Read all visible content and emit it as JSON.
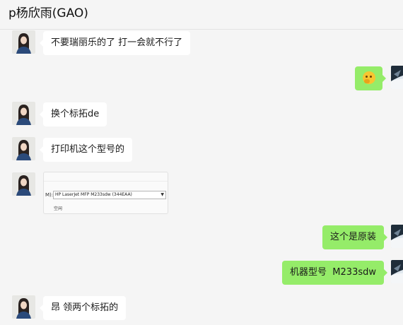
{
  "header": {
    "title": "p杨欣雨(GAO)"
  },
  "messages": [
    {
      "side": "left",
      "type": "text",
      "text": "不要瑞丽乐的了 打一会就不行了"
    },
    {
      "side": "right",
      "type": "emoji",
      "emoji": "thinking-face-icon"
    },
    {
      "side": "left",
      "type": "text",
      "text": "换个标拓de"
    },
    {
      "side": "left",
      "type": "text",
      "text": "打印机这个型号的"
    },
    {
      "side": "left",
      "type": "image",
      "image": {
        "field_label": "M):",
        "combo_value": "HP LaserJet MFP M233sdw (344EAA)",
        "caption": "空闲"
      }
    },
    {
      "side": "right",
      "type": "text",
      "text": "这个是原装"
    },
    {
      "side": "right",
      "type": "text",
      "text": "机器型号  M233sdw"
    },
    {
      "side": "left",
      "type": "text",
      "text": "昂 领两个标拓的"
    }
  ],
  "colors": {
    "background": "#f5f5f5",
    "left_bubble": "#ffffff",
    "right_bubble": "#95ec69"
  }
}
